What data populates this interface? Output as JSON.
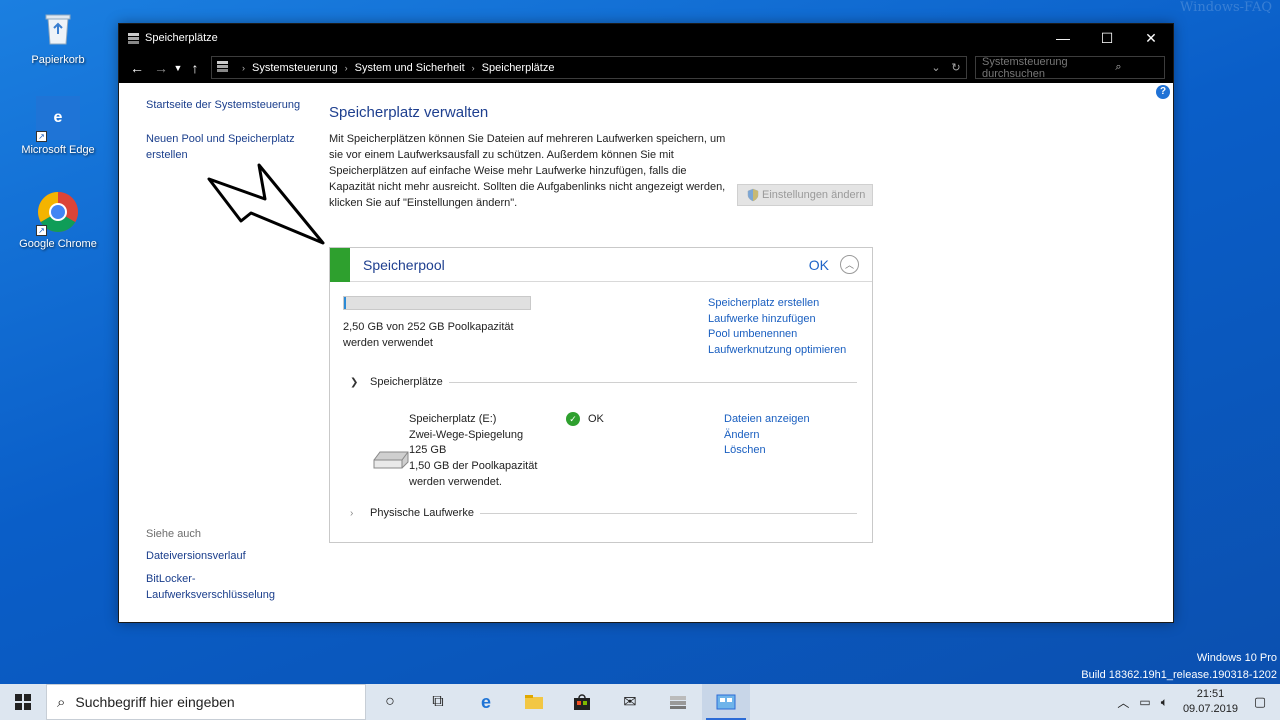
{
  "desktop": {
    "watermark": "Windows-FAQ",
    "icons": [
      {
        "label": "Papierkorb",
        "icon": "recycle-bin-icon"
      },
      {
        "label": "Microsoft Edge",
        "icon": "edge-icon"
      },
      {
        "label": "Google Chrome",
        "icon": "chrome-icon"
      }
    ],
    "os_edition": "Windows 10 Pro",
    "build": "Build 18362.19h1_release.190318-1202"
  },
  "window": {
    "title": "Speicherplätze",
    "breadcrumbs": [
      "Systemsteuerung",
      "System und Sicherheit",
      "Speicherplätze"
    ],
    "search_placeholder": "Systemsteuerung durchsuchen"
  },
  "leftpane": {
    "links": [
      "Startseite der Systemsteuerung",
      "Neuen Pool und Speicherplatz erstellen"
    ],
    "see_also_heading": "Siehe auch",
    "see_also_links": [
      "Dateiversionsverlauf",
      "BitLocker-Laufwerksverschlüsselung"
    ]
  },
  "main": {
    "heading": "Speicherplatz verwalten",
    "description": "Mit Speicherplätzen können Sie Dateien auf mehreren Laufwerken speichern, um sie vor einem Laufwerksausfall zu schützen. Außerdem können Sie mit Speicherplätzen auf einfache Weise mehr Laufwerke hinzufügen, falls die Kapazität nicht mehr ausreicht. Sollten die Aufgabenlinks nicht angezeigt werden, klicken Sie auf \"Einstellungen ändern\".",
    "settings_button": "Einstellungen ändern"
  },
  "pool": {
    "title": "Speicherpool",
    "status": "OK",
    "status_color": "#2ea02e",
    "usage_fraction": 0.0099,
    "usage_text_1": "2,50 GB von 252 GB Poolkapazität",
    "usage_text_2": "werden verwendet",
    "links": [
      "Speicherplatz erstellen",
      "Laufwerke hinzufügen",
      "Pool umbenennen",
      "Laufwerknutzung optimieren"
    ],
    "spaces_section": "Speicherplätze",
    "physical_section": "Physische Laufwerke",
    "space": {
      "name": "Speicherplatz (E:)",
      "resiliency": "Zwei-Wege-Spiegelung",
      "size": "125 GB",
      "used_1": "1,50 GB der Poolkapazität",
      "used_2": "werden verwendet.",
      "status": "OK",
      "links": [
        "Dateien anzeigen",
        "Ändern",
        "Löschen"
      ]
    }
  },
  "taskbar": {
    "search_placeholder": "Suchbegriff hier eingeben",
    "time": "21:51",
    "date": "09.07.2019",
    "accent": "#2b6bd6"
  }
}
